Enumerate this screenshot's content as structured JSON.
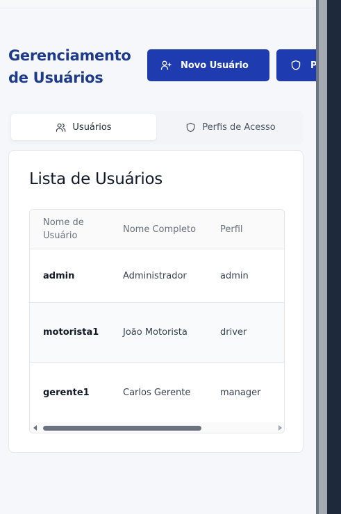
{
  "header": {
    "title": "Gerenciamento de Usuários"
  },
  "actions": {
    "new_user_label": "Novo Usuário",
    "new_user_icon": "user-plus-icon",
    "profiles_icon": "shield-icon",
    "profiles_label_visible": "P"
  },
  "tabs": [
    {
      "label": "Usuários",
      "icon": "users-icon",
      "active": true
    },
    {
      "label": "Perfis de Acesso",
      "icon": "shield-icon",
      "active": false
    }
  ],
  "card": {
    "title": "Lista de Usuários"
  },
  "table": {
    "columns": [
      "Nome de Usuário",
      "Nome Completo",
      "Perfil"
    ],
    "rows": [
      {
        "username": "admin",
        "full_name": "Administrador",
        "profile": "admin"
      },
      {
        "username": "motorista1",
        "full_name": "João Motorista",
        "profile": "driver"
      },
      {
        "username": "gerente1",
        "full_name": "Carlos Gerente",
        "profile": "manager"
      }
    ]
  },
  "colors": {
    "accent": "#1e3cb0",
    "title": "#1e3a8a",
    "background": "#f5f7fa",
    "dark_pane": "#1e2a3b"
  }
}
